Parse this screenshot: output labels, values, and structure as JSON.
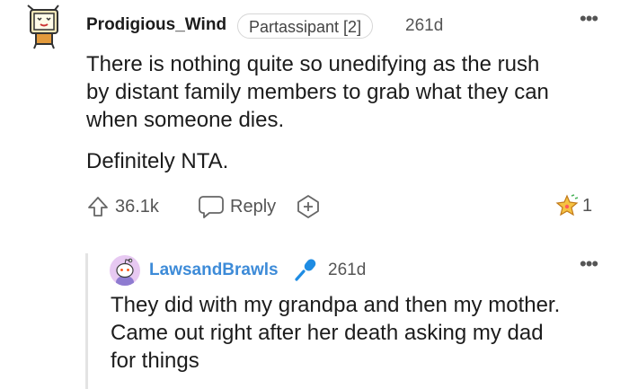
{
  "comment": {
    "username": "Prodigious_Wind",
    "flair": "Partassipant [2]",
    "age": "261d",
    "more_icon": "more-dots-icon",
    "body_lines": [
      "There is nothing quite so unedifying as the rush",
      "by distant family members to grab what they can",
      "when someone dies."
    ],
    "body_second": "Definitely NTA.",
    "votes": "36.1k",
    "reply_label": "Reply",
    "award_count": "1"
  },
  "reply": {
    "username": "LawsandBrawls",
    "username_color": "#3d8bd8",
    "age": "261d",
    "badge_icon": "microphone-icon",
    "body_lines": [
      "They did with my grandpa and then my mother.",
      "Came out right after her death asking my dad",
      "for things"
    ]
  }
}
